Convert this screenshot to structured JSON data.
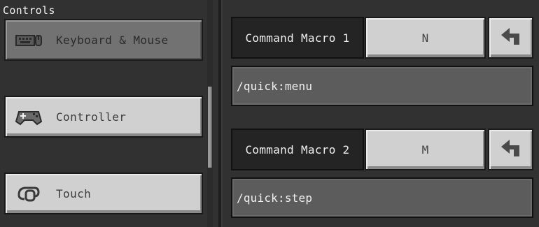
{
  "sidebar": {
    "title": "Controls",
    "items": [
      {
        "label": "Keyboard & Mouse",
        "icon": "keyboard-mouse-icon",
        "selected": true
      },
      {
        "label": "Controller",
        "icon": "controller-icon",
        "selected": false
      },
      {
        "label": "Touch",
        "icon": "touch-icon",
        "selected": false
      }
    ]
  },
  "macros": [
    {
      "label": "Command Macro 1",
      "key": "N",
      "command": "/quick:menu",
      "reset_icon": "undo-arrow-icon"
    },
    {
      "label": "Command Macro 2",
      "key": "M",
      "command": "/quick:step",
      "reset_icon": "undo-arrow-icon"
    }
  ],
  "colors": {
    "background": "#313131",
    "button": "#d0d0d0",
    "selected_button": "#727272",
    "field": "#5c5c5c",
    "label_bg": "#242424"
  }
}
